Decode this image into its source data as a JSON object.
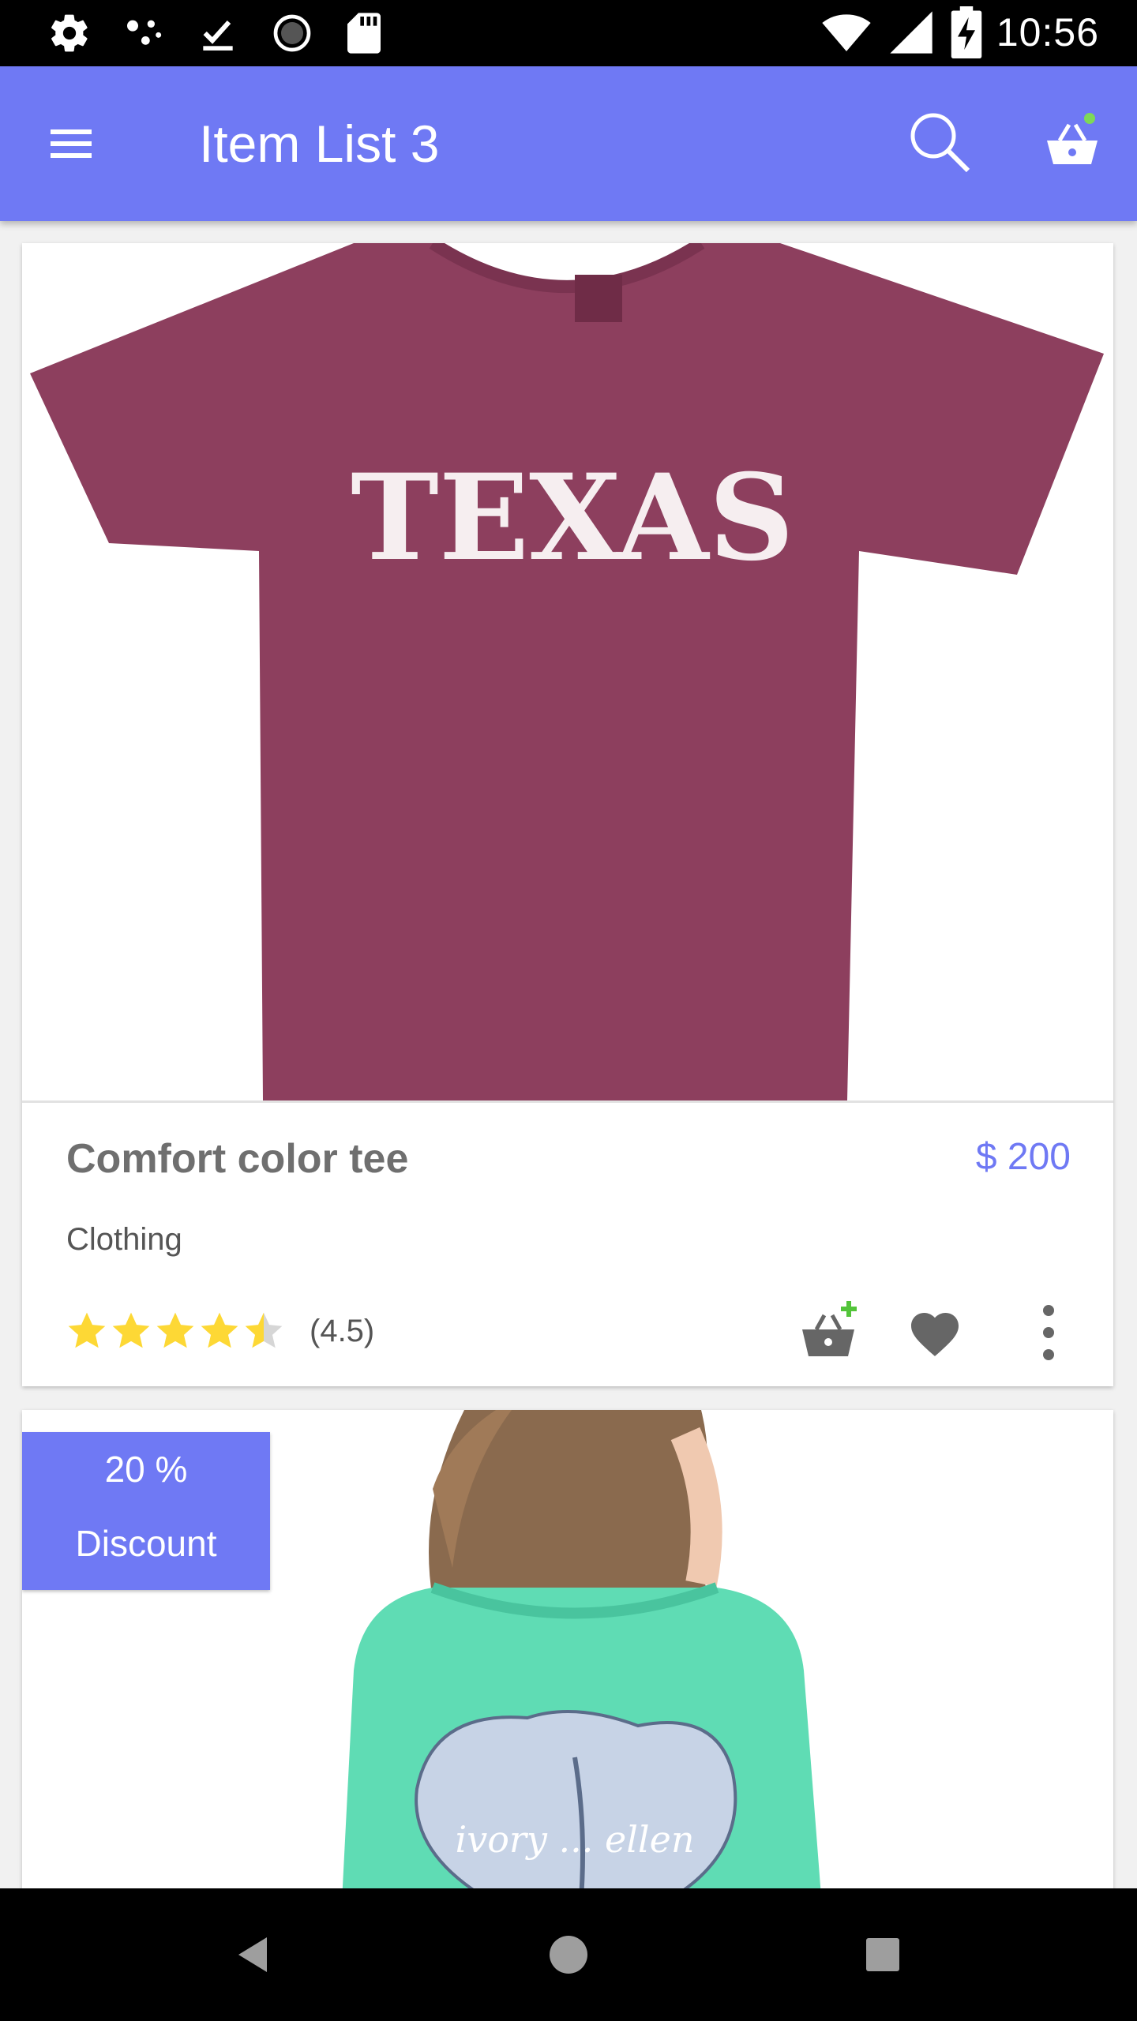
{
  "status_bar": {
    "time": "10:56"
  },
  "app_bar": {
    "title": "Item List 3"
  },
  "items": [
    {
      "image_text": "TEXAS",
      "title": "Comfort color tee",
      "price": "$ 200",
      "category": "Clothing",
      "rating_value": 4.5,
      "rating_text": "(4.5)"
    },
    {
      "discount_line1": "20 %",
      "discount_line2": "Discount",
      "image_text": "ivory ... ellen"
    }
  ],
  "colors": {
    "primary": "#6f79f4",
    "star": "#fdd835",
    "shirt": "#8d3f5e",
    "teal_shirt": "#5fdcb4"
  }
}
